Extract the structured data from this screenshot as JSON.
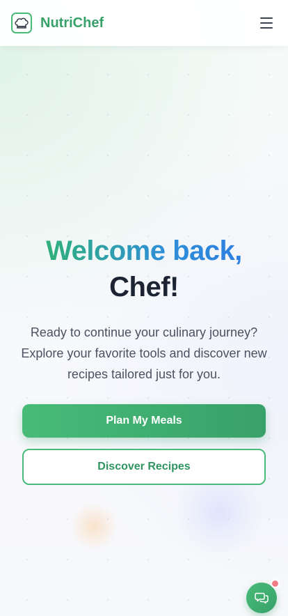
{
  "header": {
    "brand_name": "NutriChef",
    "logo_icon": "chef-hat-icon",
    "menu_icon": "hamburger-menu-icon"
  },
  "hero": {
    "title_line1": "Welcome back,",
    "title_line2": "Chef!",
    "subtitle": "Ready to continue your culinary journey? Explore your favorite tools and discover new recipes tailored just for you."
  },
  "actions": {
    "primary_label": "Plan My Meals",
    "secondary_label": "Discover Recipes"
  },
  "chat": {
    "icon": "chat-bubbles-icon",
    "has_notification": true
  },
  "colors": {
    "brand_green": "#38a169",
    "accent_green": "#48bb78",
    "accent_blue": "#2f8fd8",
    "title_dark": "#1c2433",
    "notification": "#f07a86"
  }
}
